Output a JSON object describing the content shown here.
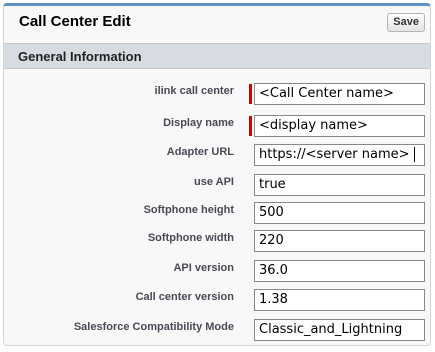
{
  "header": {
    "title": "Call Center Edit",
    "save_label": "Save"
  },
  "section": {
    "title": "General Information"
  },
  "fields": [
    {
      "label": "ilink call center",
      "value": "<Call Center name>",
      "required": true
    },
    {
      "label": "Display name",
      "value": "<display name>",
      "required": true
    },
    {
      "label": "Adapter URL",
      "value": "https://<server name>",
      "required": false
    },
    {
      "label": "use API",
      "value": "true",
      "required": false
    },
    {
      "label": "Softphone height",
      "value": "500",
      "required": false
    },
    {
      "label": "Softphone width",
      "value": "220",
      "required": false
    },
    {
      "label": "API version",
      "value": "36.0",
      "required": false
    },
    {
      "label": "Call center version",
      "value": "1.38",
      "required": false
    },
    {
      "label": "Salesforce Compatibility Mode",
      "value": "Classic_and_Lightning",
      "required": false
    }
  ],
  "colors": {
    "accent": "#5f93c5",
    "required": "#cc0000",
    "section_bg": "#d7dce2"
  }
}
